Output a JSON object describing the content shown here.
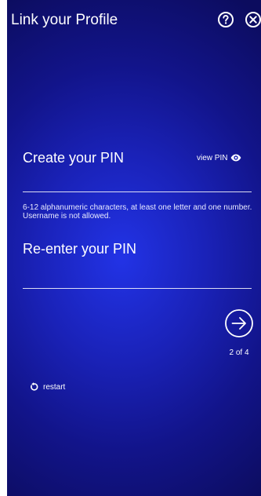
{
  "header": {
    "title": "Link your Profile",
    "help_icon": "help-circle-icon",
    "close_icon": "close-circle-icon"
  },
  "pin": {
    "label": "Create your PIN",
    "view_label": "view PIN",
    "view_icon": "eye-icon",
    "value": "",
    "hint": "6-12 alphanumeric characters, at least one letter and one number. Username is not allowed."
  },
  "reenter": {
    "label": "Re-enter your PIN",
    "value": ""
  },
  "navigation": {
    "next_icon": "arrow-right-circle-icon",
    "step": "2 of 4",
    "restart_label": "restart",
    "restart_icon": "restart-icon"
  },
  "colors": {
    "background_center": "#2233e6",
    "background_edge": "#0c0c5e",
    "text": "#ffffff"
  }
}
